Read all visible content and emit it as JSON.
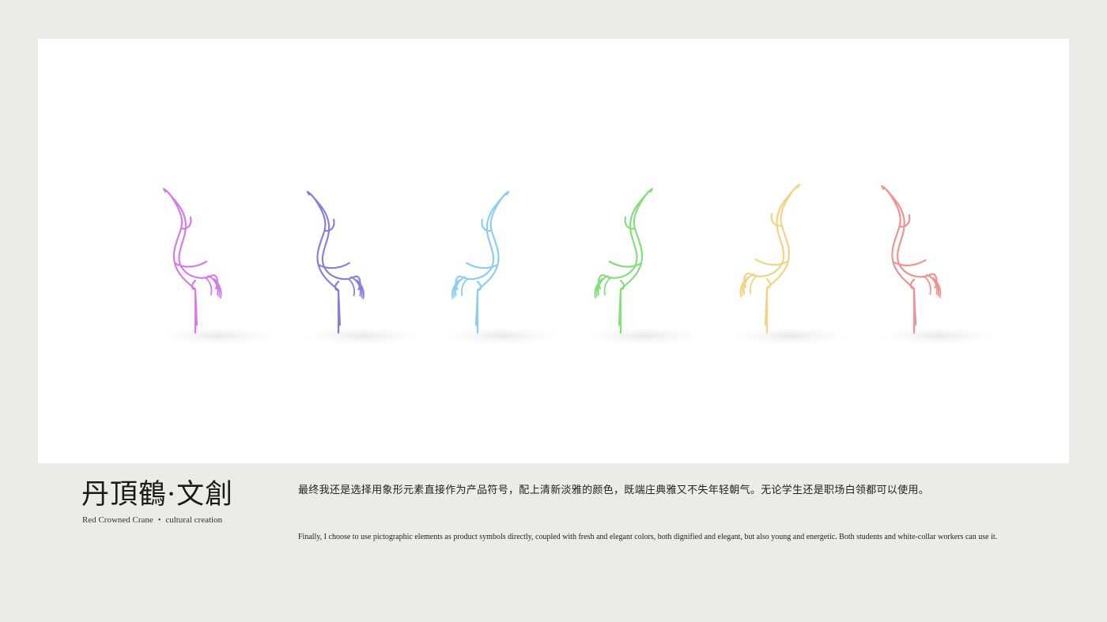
{
  "product": {
    "title": "丹頂鶴·文創",
    "subtitle_left": "Red Crowned Crane",
    "subtitle_separator": "•",
    "subtitle_right": "cultural creation"
  },
  "description": {
    "chinese": "最终我还是选择用象形元素直接作为产品符号，配上清新淡雅的颜色，既端庄典雅又不失年轻朝气。无论学生还是职场白领都可以使用。",
    "english": "Finally, I choose to use pictographic elements as product symbols directly, coupled with fresh and elegant colors, both dignified and elegant, but also young and energetic. Both students and white-collar workers can use it."
  },
  "cranes": [
    {
      "color_name": "magenta",
      "color": "#d77be6"
    },
    {
      "color_name": "violet",
      "color": "#8680dc"
    },
    {
      "color_name": "sky-blue",
      "color": "#8ccdf2"
    },
    {
      "color_name": "green",
      "color": "#86dd7c"
    },
    {
      "color_name": "yellow",
      "color": "#f0d488"
    },
    {
      "color_name": "coral",
      "color": "#ef9494"
    }
  ]
}
